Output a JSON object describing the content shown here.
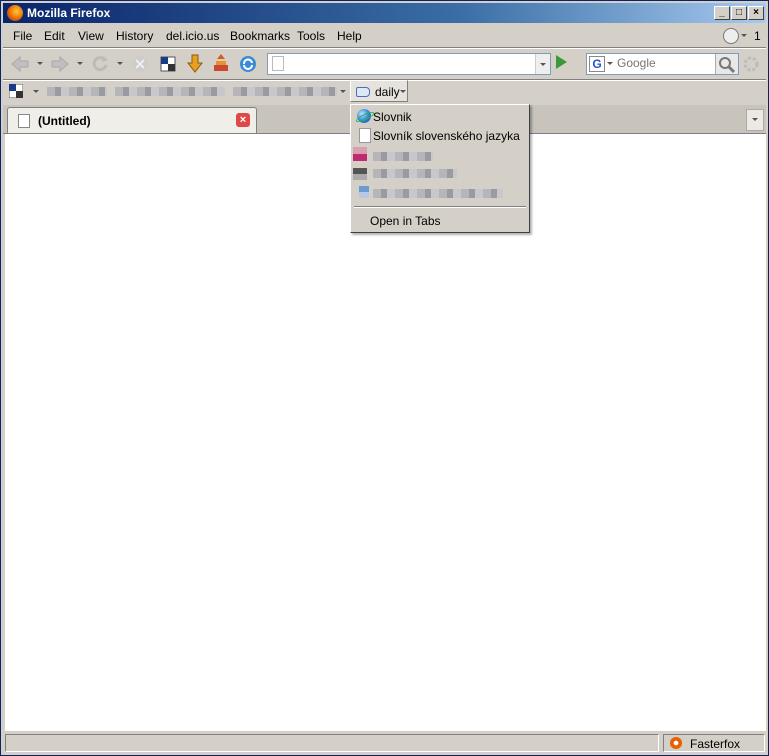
{
  "window": {
    "title": "Mozilla Firefox"
  },
  "menubar": {
    "items": [
      {
        "label": "File"
      },
      {
        "label": "Edit"
      },
      {
        "label": "View"
      },
      {
        "label": "History"
      },
      {
        "label": "del.icio.us"
      },
      {
        "label": "Bookmarks"
      },
      {
        "label": "Tools"
      },
      {
        "label": "Help"
      }
    ],
    "right_counter": "1"
  },
  "search": {
    "placeholder": "Google",
    "engine_letter": "G"
  },
  "bookmarks_toolbar": {
    "daily_label": "daily"
  },
  "daily_menu": {
    "items": [
      {
        "label": "Slovnik",
        "icon": "globe-icon"
      },
      {
        "label": "Slovník slovenského jazyka",
        "icon": "page-icon"
      }
    ],
    "open_in_tabs": "Open in Tabs"
  },
  "tab": {
    "title": "(Untitled)"
  },
  "statusbar": {
    "addon_label": "Fasterfox"
  }
}
